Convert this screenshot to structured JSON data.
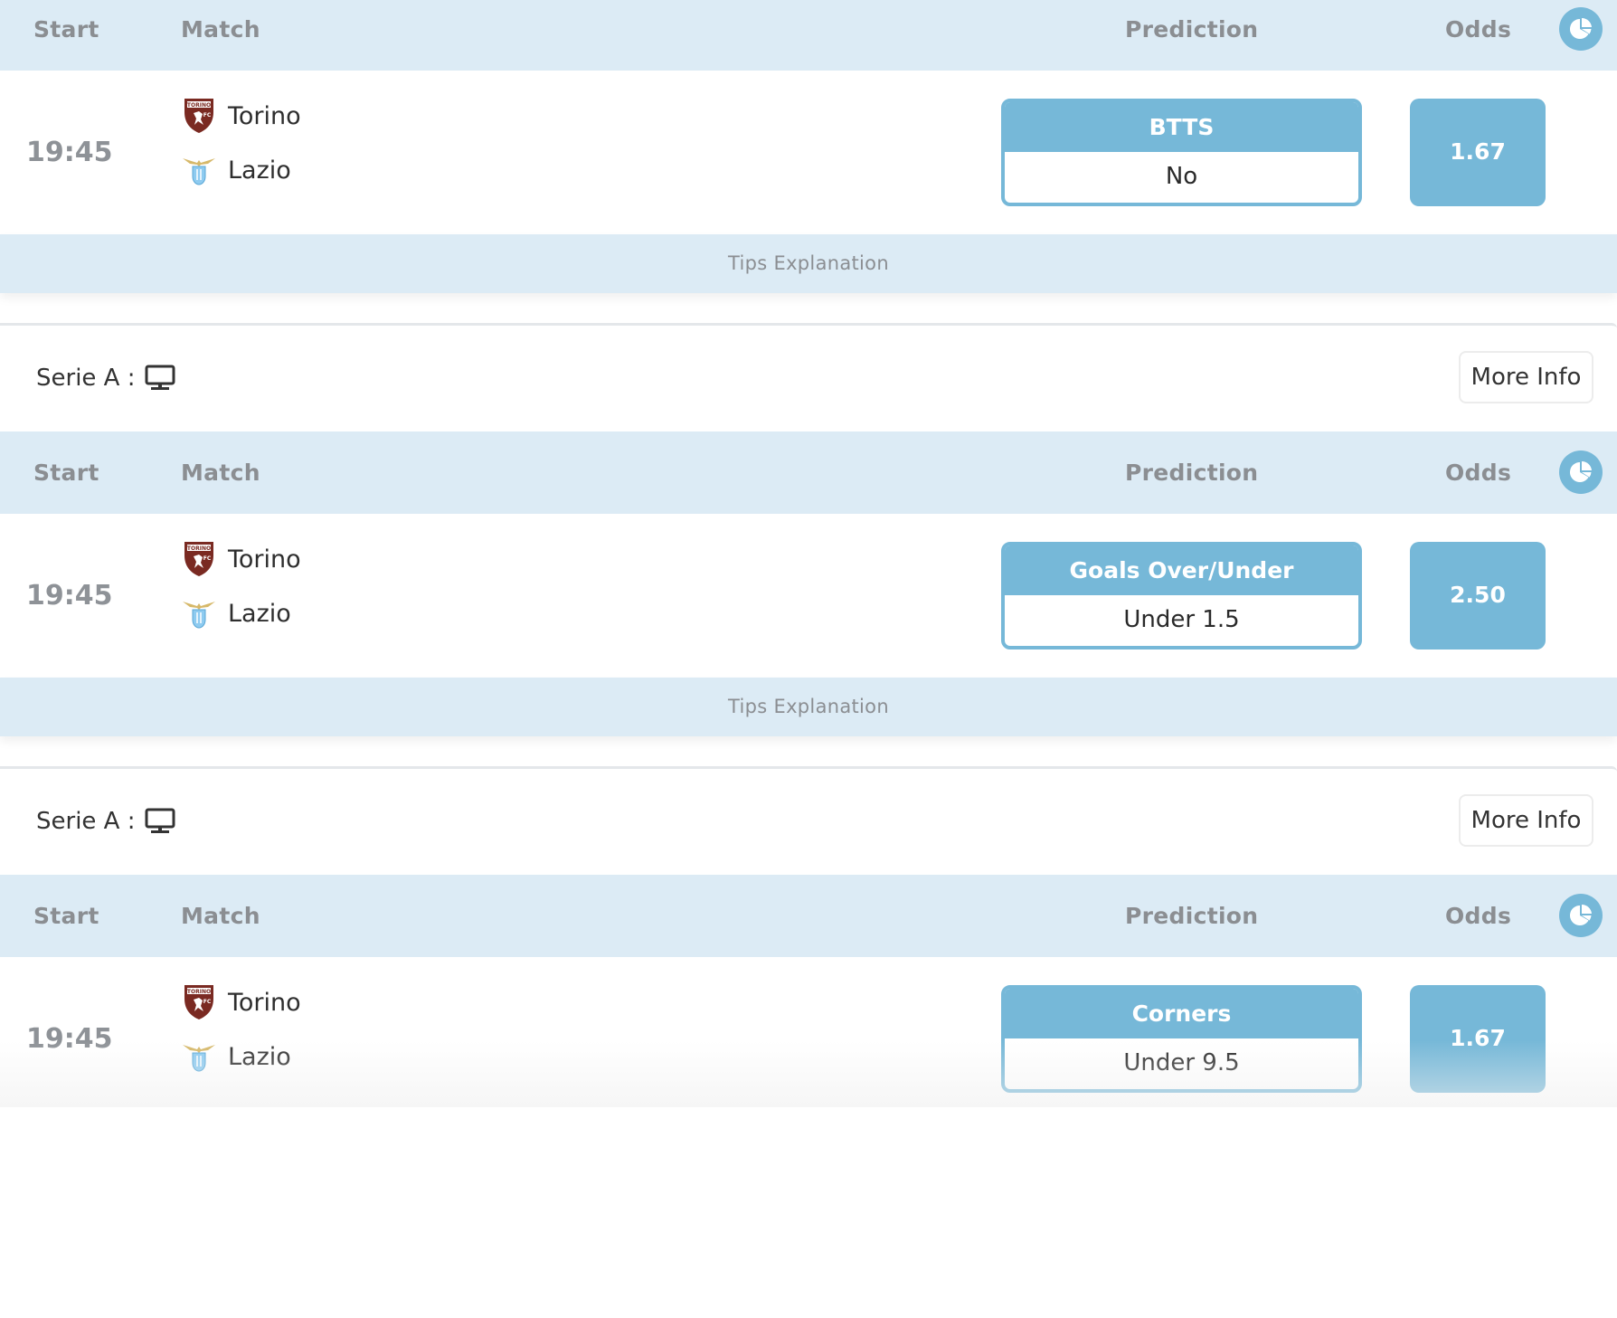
{
  "table_headers": {
    "start": "Start",
    "match": "Match",
    "prediction": "Prediction",
    "odds": "Odds",
    "stats_icon": "pie-chart-icon"
  },
  "colors": {
    "accent": "#76b8d8",
    "header_bg": "#dcebf5",
    "header_text": "#8b8e92"
  },
  "tips_label": "Tips Explanation",
  "more_info_label": "More Info",
  "league_label": "Serie A :",
  "league_icon": "tv-icon",
  "matches": [
    {
      "start": "19:45",
      "home": "Torino",
      "away": "Lazio",
      "market": "BTTS",
      "pick": "No",
      "odds": "1.67"
    },
    {
      "start": "19:45",
      "home": "Torino",
      "away": "Lazio",
      "market": "Goals Over/Under",
      "pick": "Under 1.5",
      "odds": "2.50"
    },
    {
      "start": "19:45",
      "home": "Torino",
      "away": "Lazio",
      "market": "Corners",
      "pick": "Under 9.5",
      "odds": "1.67"
    }
  ]
}
